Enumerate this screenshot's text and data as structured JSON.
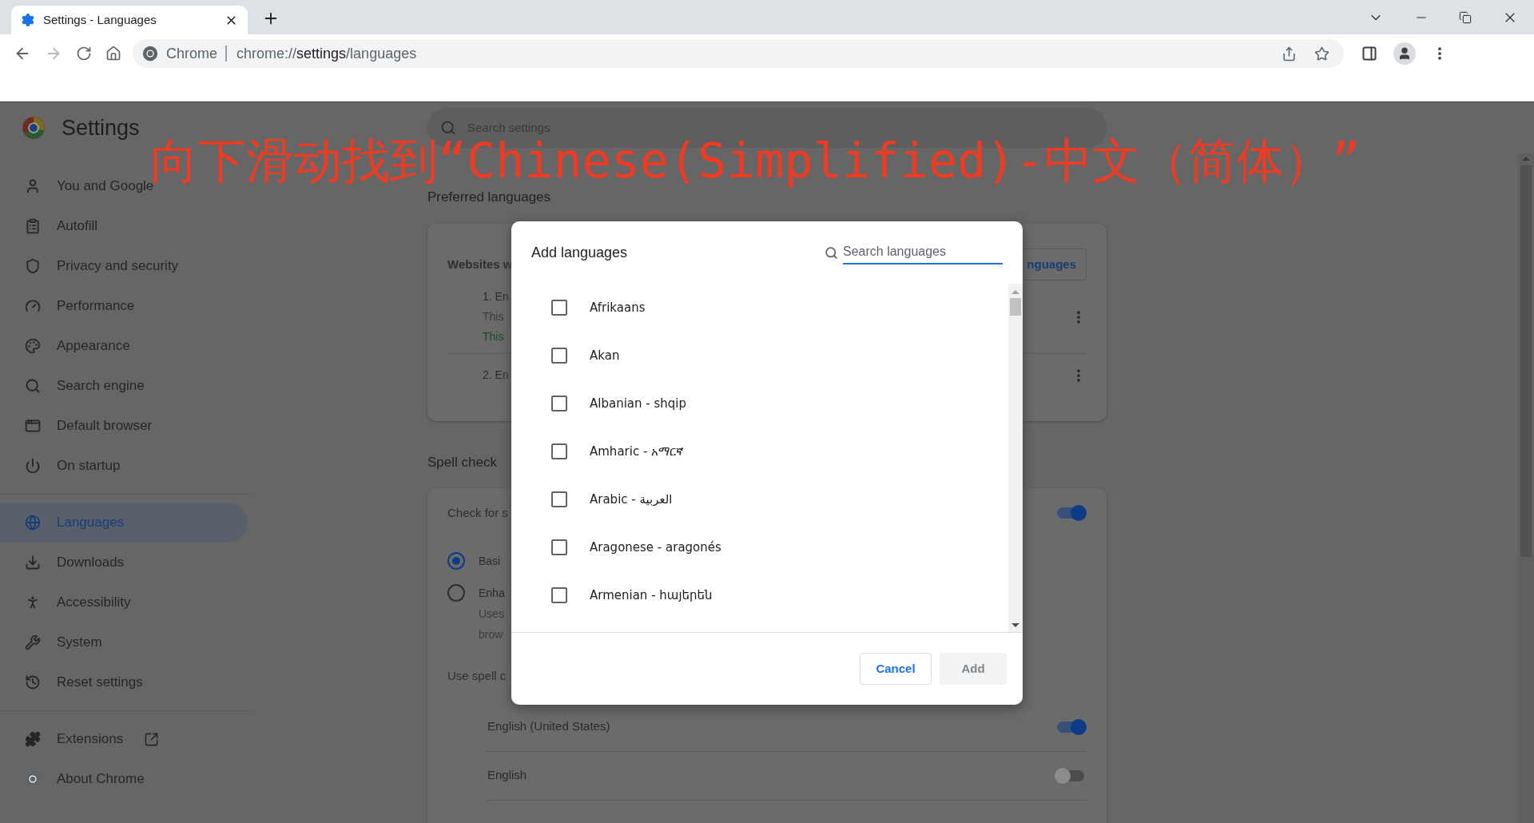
{
  "browser": {
    "tab": {
      "title": "Settings - Languages",
      "selected": true
    },
    "omnibox": {
      "chip": "Chrome",
      "url": [
        {
          "text": "chrome://",
          "kind": "dim"
        },
        {
          "text": "settings",
          "kind": "host"
        },
        {
          "text": "/languages",
          "kind": "dim"
        }
      ]
    }
  },
  "settings": {
    "title": "Settings",
    "search_placeholder": "Search settings",
    "nav": [
      {
        "label": "You and Google",
        "selected": false
      },
      {
        "label": "Autofill",
        "selected": false
      },
      {
        "label": "Privacy and security",
        "selected": false
      },
      {
        "label": "Performance",
        "selected": false
      },
      {
        "label": "Appearance",
        "selected": false
      },
      {
        "label": "Search engine",
        "selected": false
      },
      {
        "label": "Default browser",
        "selected": false
      },
      {
        "label": "On startup",
        "selected": false
      },
      {
        "label": "Languages",
        "selected": true
      },
      {
        "label": "Downloads",
        "selected": false
      },
      {
        "label": "Accessibility",
        "selected": false
      },
      {
        "label": "System",
        "selected": false
      },
      {
        "label": "Reset settings",
        "selected": false
      }
    ],
    "nav_footer": [
      {
        "label": "Extensions",
        "kind": "external"
      },
      {
        "label": "About Chrome",
        "kind": "plain"
      }
    ]
  },
  "preferred": {
    "heading": "Preferred languages",
    "intro": "Websites w",
    "button": "nguages",
    "languages": [
      {
        "name": "1. En",
        "lines": [
          {
            "text": "This",
            "kind": "note"
          },
          {
            "text": "This",
            "kind": "status"
          }
        ]
      },
      {
        "name": "2. En"
      }
    ]
  },
  "spell_check": {
    "heading": "Spell check",
    "toggle_label": "Check for s",
    "on": true,
    "options": [
      {
        "label": "Basi",
        "selected": true
      },
      {
        "label": "Enha",
        "description": [
          "Uses",
          "brow"
        ],
        "selected": false
      }
    ],
    "languages_label": "Use spell c",
    "languages": [
      {
        "name": "English (United States)",
        "on": true
      },
      {
        "name": "English",
        "on": false
      }
    ]
  },
  "annotation": "向下滑动找到“Chinese(Simplified)-中文（简体）”",
  "dialog": {
    "title": "Add languages",
    "search_placeholder": "Search languages",
    "languages": [
      {
        "name": "Afrikaans",
        "checked": false
      },
      {
        "name": "Akan",
        "checked": false
      },
      {
        "name": "Albanian - shqip",
        "checked": false
      },
      {
        "name": "Amharic - አማርኛ",
        "checked": false
      },
      {
        "name": "Arabic - العربية",
        "checked": false
      },
      {
        "name": "Aragonese - aragonés",
        "checked": false
      },
      {
        "name": "Armenian - հայերեն",
        "checked": false
      }
    ],
    "buttons": [
      {
        "label": "Cancel",
        "disabled": false
      },
      {
        "label": "Add",
        "disabled": true
      }
    ]
  }
}
